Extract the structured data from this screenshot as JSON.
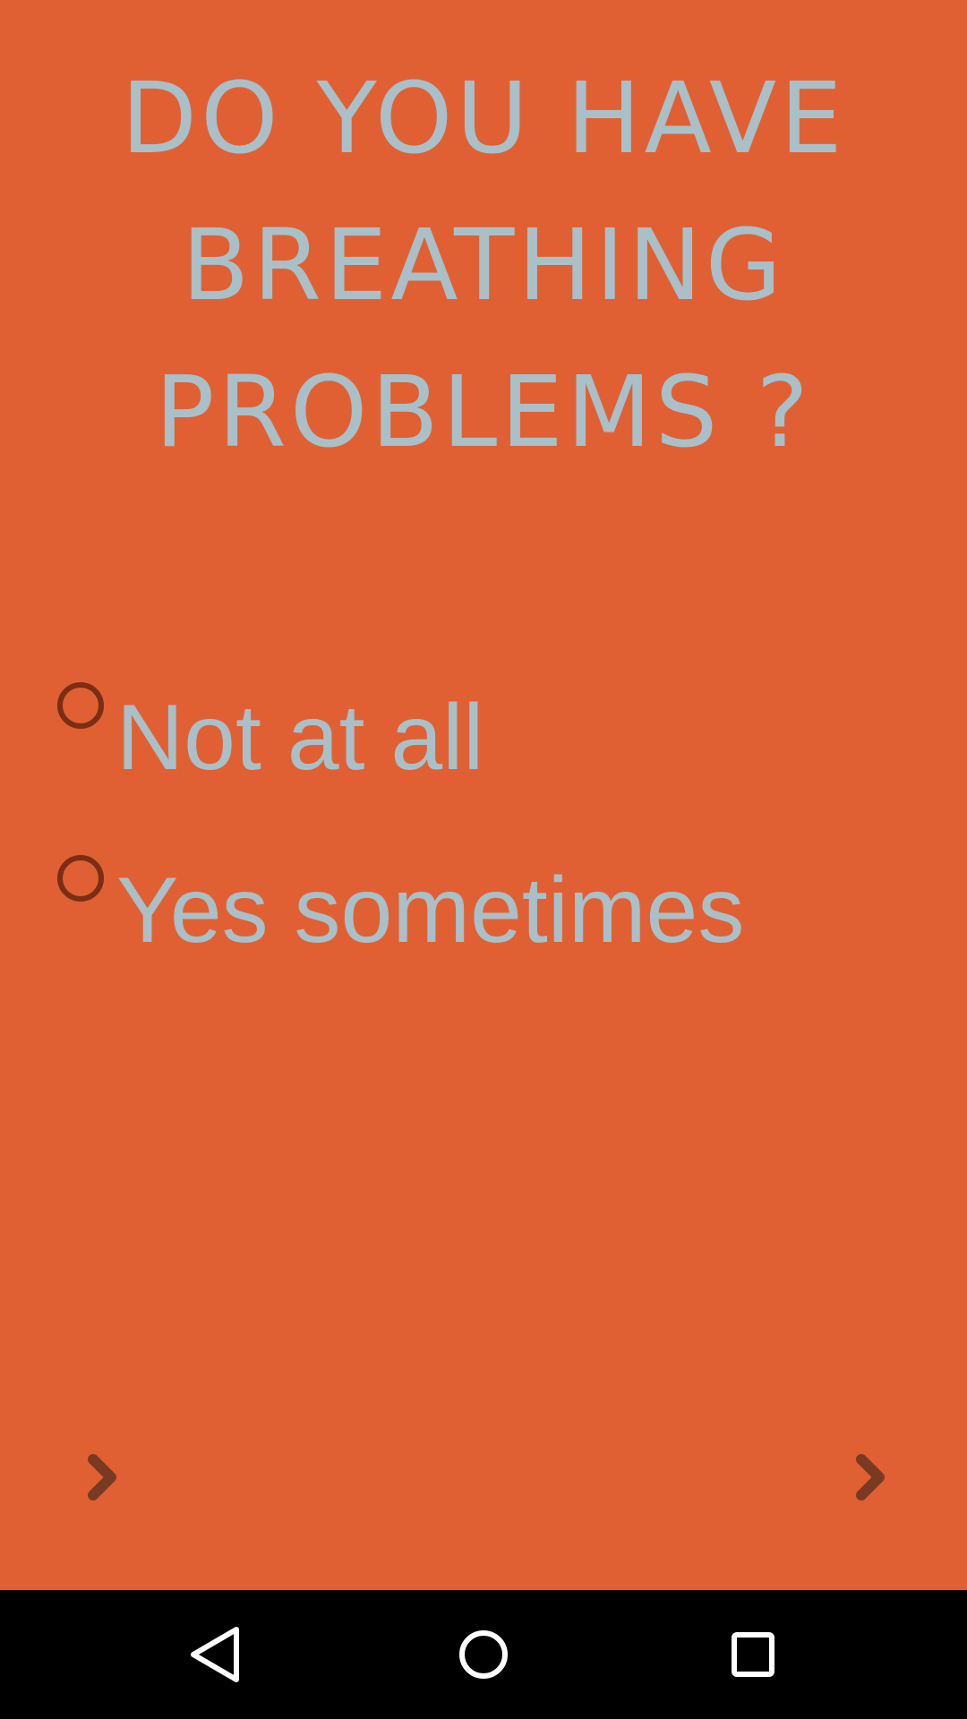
{
  "question": {
    "lines": [
      "DO YOU HAVE",
      "BREATHING",
      "PROBLEMS ?"
    ]
  },
  "options": [
    {
      "label": "Not at all",
      "selected": false
    },
    {
      "label": "Yes sometimes",
      "selected": false
    }
  ],
  "navigation": {
    "left_icon": "chevron-right-icon",
    "right_icon": "chevron-right-icon"
  },
  "system_bar": {
    "back_icon": "back-triangle-icon",
    "home_icon": "home-circle-icon",
    "recents_icon": "recents-square-icon"
  },
  "colors": {
    "background": "#e06034",
    "text": "#a9c0c8",
    "radio_border": "#7a2e14",
    "arrow": "#7a3a22",
    "system_bar": "#000000"
  }
}
